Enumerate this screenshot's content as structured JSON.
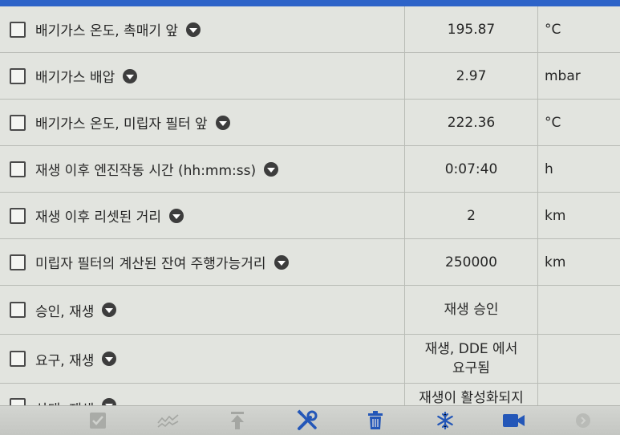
{
  "rows": [
    {
      "label": "배기가스 온도, 촉매기 앞",
      "value": "195.87",
      "unit": "°C"
    },
    {
      "label": "배기가스 배압",
      "value": "2.97",
      "unit": "mbar"
    },
    {
      "label": "배기가스 온도, 미립자 필터 앞",
      "value": "222.36",
      "unit": "°C"
    },
    {
      "label": "재생 이후 엔진작동 시간 (hh:mm:ss)",
      "value": "0:07:40",
      "unit": "h"
    },
    {
      "label": "재생 이후 리셋된 거리",
      "value": "2",
      "unit": "km"
    },
    {
      "label": "미립자 필터의 계산된 잔여 주행가능거리",
      "value": "250000",
      "unit": "km"
    },
    {
      "label": "승인, 재생",
      "value": "재생 승인",
      "unit": ""
    },
    {
      "label": "요구, 재생",
      "value": "재생, DDE 에서\n요구됨",
      "unit": ""
    },
    {
      "label": "상태, 재생",
      "value": "재생이 활성화되지",
      "unit": ""
    }
  ],
  "toolbar": {
    "icons": [
      "check-icon",
      "chart-icon",
      "upload-arrow-icon",
      "tools-icon",
      "trash-icon",
      "snowflake-icon",
      "video-camera-icon",
      "circle-icon"
    ],
    "accent": "#2d63c8"
  }
}
